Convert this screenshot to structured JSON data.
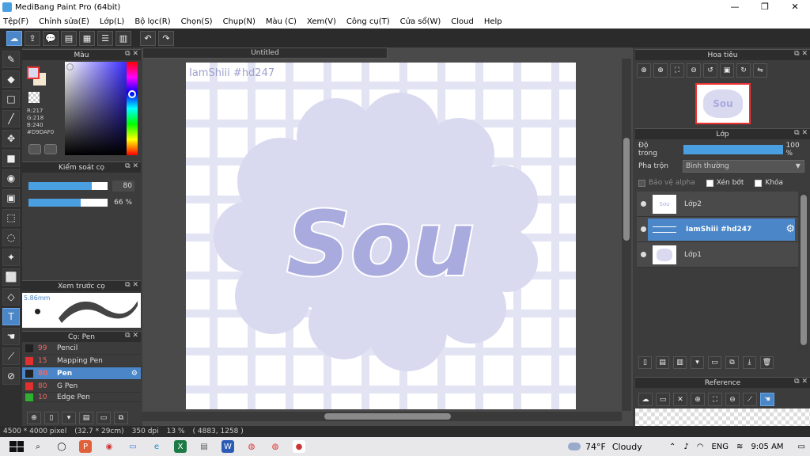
{
  "window": {
    "title": "MediBang Paint Pro (64bit)",
    "minimize": "—",
    "restore": "❐",
    "close": "✕"
  },
  "menu": [
    "Tệp(F)",
    "Chỉnh sửa(E)",
    "Lớp(L)",
    "Bộ lọc(R)",
    "Chọn(S)",
    "Chụp(N)",
    "Màu (C)",
    "Xem(V)",
    "Công cụ(T)",
    "Cửa sổ(W)",
    "Cloud",
    "Help"
  ],
  "panels": {
    "color": {
      "title": "Màu",
      "r": "R:217",
      "g": "G:218",
      "b": "B:240",
      "hex": "#D9DAF0",
      "current_color": "#D9DAF0"
    },
    "brush_control": {
      "title": "Kiểm soát cọ",
      "size_value": "80",
      "opacity_value": "66 %",
      "size_level": 0.8,
      "opacity_level": 0.66
    },
    "brush_preview": {
      "title": "Xem trước cọ",
      "size": "5.86mm"
    },
    "brushes": {
      "title": "Cọ: Pen",
      "items": [
        {
          "num": "99",
          "name": "Pencil",
          "color": "#222222"
        },
        {
          "num": "15",
          "name": "Mapping Pen",
          "color": "#e03030"
        },
        {
          "num": "80",
          "name": "Pen",
          "color": "#222222",
          "active": true
        },
        {
          "num": "80",
          "name": "G Pen",
          "color": "#e03030"
        },
        {
          "num": "10",
          "name": "Edge Pen",
          "color": "#30b030"
        }
      ]
    },
    "navigator": {
      "title": "Hoa tiêu"
    },
    "layers": {
      "title": "Lớp",
      "opacity_label": "Độ trong",
      "opacity_value": "100 %",
      "blend_label": "Pha trộn",
      "blend_value": "Bình thường",
      "protect_alpha": "Bảo vệ alpha",
      "clipping": "Xén bớt",
      "lock": "Khóa",
      "items": [
        {
          "name": "Lớp2"
        },
        {
          "name": "IamShiii #hd247",
          "active": true
        },
        {
          "name": "Lớp1"
        }
      ]
    },
    "reference": {
      "title": "Reference"
    }
  },
  "document": {
    "tab": "Untitled",
    "watermark": "IamShiii #hd247",
    "artwork_text": "Sou"
  },
  "status": {
    "size": "4500 * 4000 pixel",
    "physical": "(32.7 * 29cm)",
    "dpi": "350 dpi",
    "zoom": "13 %",
    "coords": "( 4883, 1258 )"
  },
  "taskbar": {
    "weather_temp": "74°F",
    "weather_text": "Cloudy",
    "lang": "ENG",
    "time": "9:05 AM"
  }
}
